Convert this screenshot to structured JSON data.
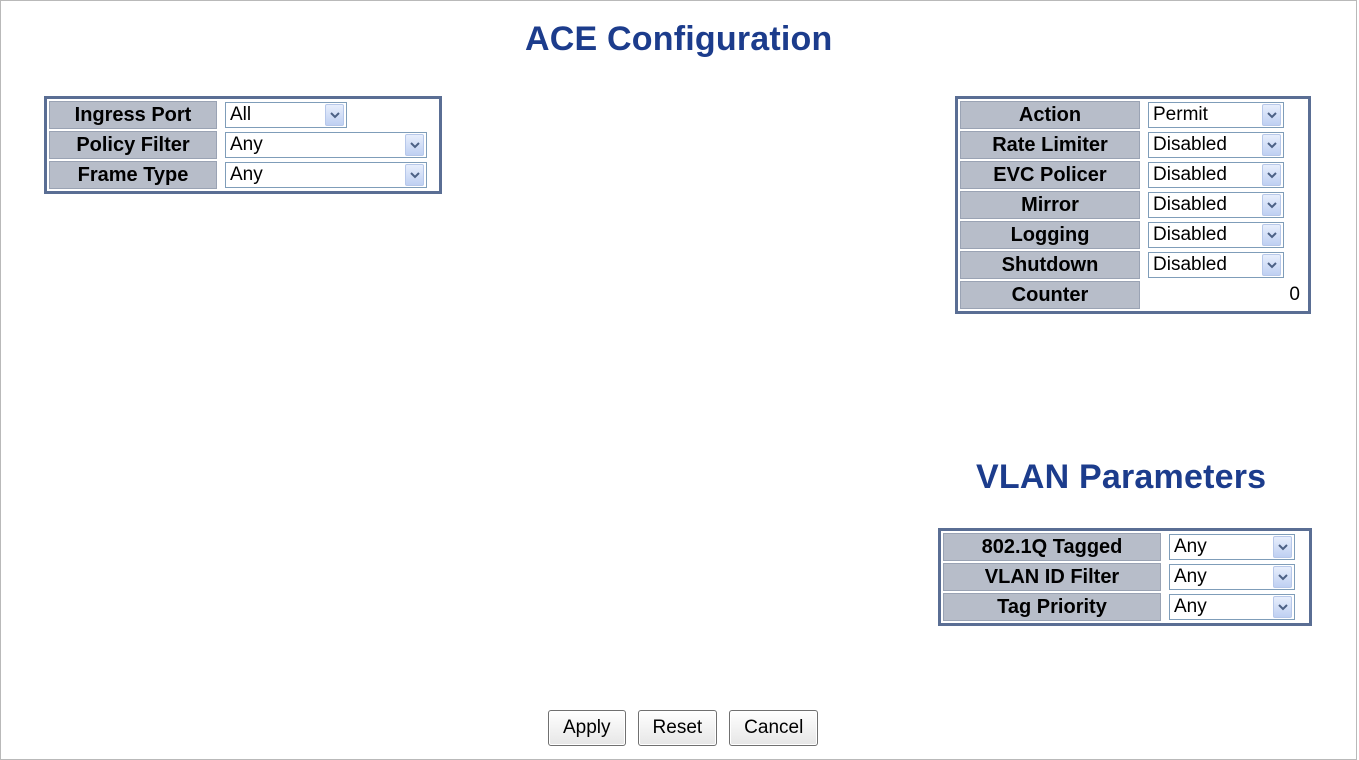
{
  "page": {
    "title": "ACE Configuration",
    "vlan_title": "VLAN Parameters"
  },
  "left_table": {
    "rows": [
      {
        "label": "Ingress Port",
        "value": "All"
      },
      {
        "label": "Policy Filter",
        "value": "Any"
      },
      {
        "label": "Frame Type",
        "value": "Any"
      }
    ]
  },
  "right_table": {
    "rows": [
      {
        "label": "Action",
        "value": "Permit"
      },
      {
        "label": "Rate Limiter",
        "value": "Disabled"
      },
      {
        "label": "EVC Policer",
        "value": "Disabled"
      },
      {
        "label": "Mirror",
        "value": "Disabled"
      },
      {
        "label": "Logging",
        "value": "Disabled"
      },
      {
        "label": "Shutdown",
        "value": "Disabled"
      },
      {
        "label": "Counter",
        "value": "0"
      }
    ]
  },
  "vlan_table": {
    "rows": [
      {
        "label": "802.1Q Tagged",
        "value": "Any"
      },
      {
        "label": "VLAN ID Filter",
        "value": "Any"
      },
      {
        "label": "Tag Priority",
        "value": "Any"
      }
    ]
  },
  "buttons": {
    "apply": "Apply",
    "reset": "Reset",
    "cancel": "Cancel"
  },
  "colors": {
    "title": "#1c3c8c",
    "header_cell": "#b7bdc9",
    "table_border": "#5a6e94"
  },
  "icons": {
    "dropdown": "chevron-down-icon"
  }
}
